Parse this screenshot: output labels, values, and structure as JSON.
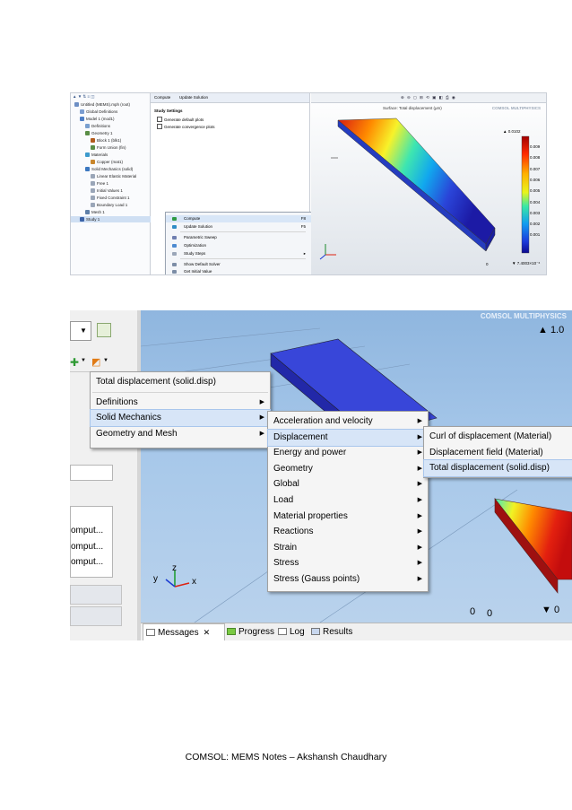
{
  "top_screenshot": {
    "tree_items": [
      "Untitled (MEMS).mph (root)",
      "Global Definitions",
      "Model 1 (mod1)",
      "Definitions",
      "Geometry 1",
      "Block 1 (blk1)",
      "Form Union (fin)",
      "Materials",
      "Copper (mat1)",
      "Solid Mechanics (solid)",
      "Linear Elastic Material",
      "Free 1",
      "Initial Values 1",
      "Fixed Constraint 1",
      "Boundary Load 1",
      "Mesh 1",
      "Study 1"
    ],
    "settings_tabs": [
      "Compute",
      "Update Solution"
    ],
    "settings_section": "Study Settings",
    "settings_options": [
      "Generate default plots",
      "Generate convergence plots"
    ],
    "context_menu": [
      "Compute",
      "Update Solution",
      "Parametric Sweep",
      "Optimization",
      "Study Steps",
      "Show Default Solver",
      "Get Initial Value"
    ],
    "context_shortcuts": [
      "F8",
      "F5"
    ],
    "plot_title": "Surface: Total displacement (μm)",
    "colorbar_max": "▲ 0.0102",
    "colorbar_ticks": [
      "0.009",
      "0.008",
      "0.007",
      "0.006",
      "0.005",
      "0.004",
      "0.003",
      "0.002",
      "0.001"
    ],
    "colorbar_min": "▼ 7.4003×10⁻⁶",
    "axis_tick": "0",
    "logo_text": "COMSOL MULTIPHYSICS"
  },
  "bottom_screenshot": {
    "left_partial_items": [
      "omput...",
      "omput...",
      "omput..."
    ],
    "menu_level1": [
      "Total displacement (solid.disp)",
      "Definitions",
      "Solid Mechanics",
      "Geometry and Mesh"
    ],
    "menu_level2": [
      "Acceleration and velocity",
      "Displacement",
      "Energy and power",
      "Geometry",
      "Global",
      "Load",
      "Material properties",
      "Reactions",
      "Strain",
      "Stress",
      "Stress (Gauss points)"
    ],
    "menu_level3": [
      "Curl of displacement (Material)",
      "Displacement field (Material)",
      "Total displacement (solid.disp)"
    ],
    "bottom_tabs": [
      "Messages",
      "Progress",
      "Log",
      "Results"
    ],
    "axes": {
      "x": "x",
      "y": "y",
      "z": "z"
    },
    "colorbar_max": "▲ 1.0",
    "colorbar_min": "▼ 0",
    "axis_ticks": [
      "0",
      "0"
    ],
    "logo_text": "COMSOL MULTIPHYSICS"
  },
  "caption": "COMSOL: MEMS Notes – Akshansh Chaudhary"
}
